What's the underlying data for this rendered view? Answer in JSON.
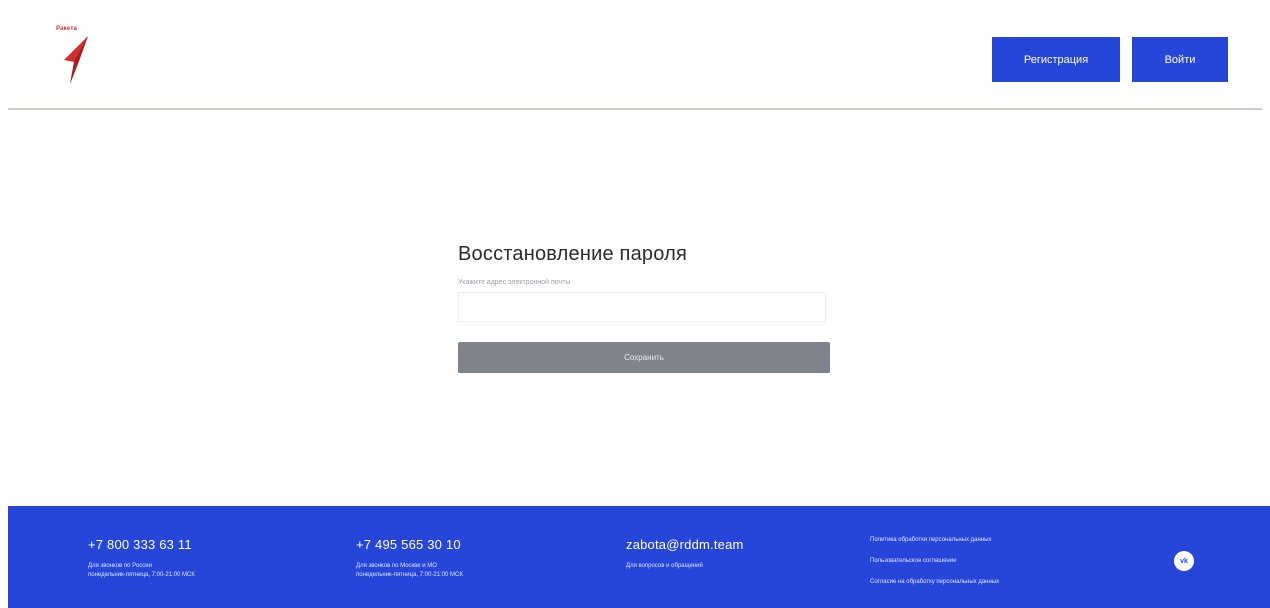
{
  "header": {
    "logo_text": "Ракета",
    "register_label": "Регистрация",
    "login_label": "Войти"
  },
  "form": {
    "title": "Восстановление пароля",
    "email_label": "Укажите адрес электронной почты",
    "email_value": "",
    "save_label": "Сохранить"
  },
  "footer": {
    "contacts": [
      {
        "phone": "+7 800 333 63 11",
        "note_line1": "Для звонков по России",
        "note_line2": "понедельник-пятница, 7:00-21:00 МСК"
      },
      {
        "phone": "+7 495 565 30 10",
        "note_line1": "Для звонков по Москве и МО",
        "note_line2": "понедельник-пятница, 7:00-21:00 МСК"
      },
      {
        "phone": "zabota@rddm.team",
        "note_line1": "Для вопросов и обращений",
        "note_line2": ""
      }
    ],
    "links": [
      "Политика обработки персональных данных",
      "Пользовательское соглашение",
      "Согласие на обработку персональных данных"
    ],
    "vk_label": "vk"
  },
  "colors": {
    "primary": "#2546d9",
    "button_disabled": "#7f848c",
    "logo_red": "#d32f2f"
  }
}
